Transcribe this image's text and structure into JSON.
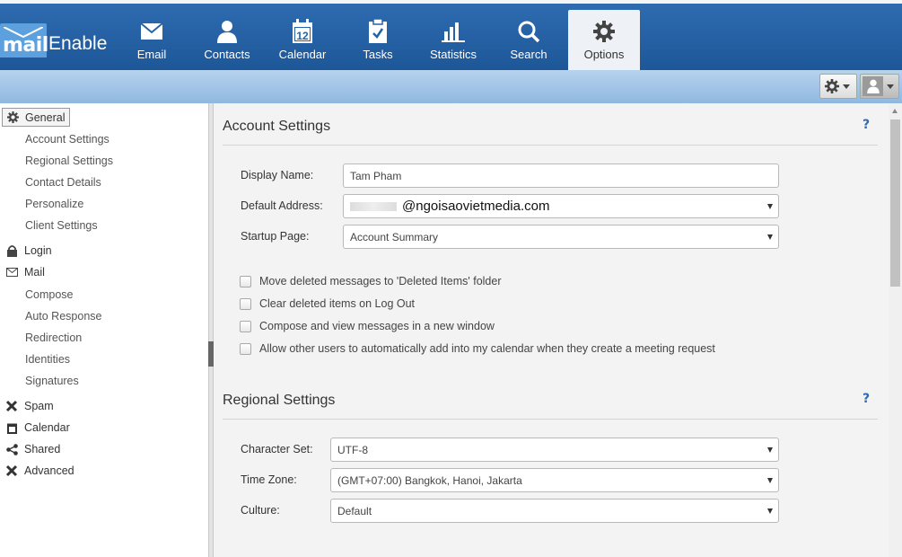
{
  "brand": {
    "logo_mail": "mail",
    "logo_enable": "Enable"
  },
  "nav": {
    "items": [
      {
        "label": "Email",
        "icon": "envelope-icon"
      },
      {
        "label": "Contacts",
        "icon": "person-icon"
      },
      {
        "label": "Calendar",
        "icon": "calendar-icon",
        "calendar_day": "12"
      },
      {
        "label": "Tasks",
        "icon": "clipboard-check-icon"
      },
      {
        "label": "Statistics",
        "icon": "bar-chart-icon"
      },
      {
        "label": "Search",
        "icon": "search-icon"
      },
      {
        "label": "Options",
        "icon": "gear-icon",
        "active": true
      }
    ]
  },
  "toolbar": {
    "settings_icon": "gear-icon",
    "user_icon": "user-icon"
  },
  "sidebar": {
    "general": "General",
    "general_items": [
      "Account Settings",
      "Regional Settings",
      "Contact Details",
      "Personalize",
      "Client Settings"
    ],
    "login": "Login",
    "mail": "Mail",
    "mail_items": [
      "Compose",
      "Auto Response",
      "Redirection",
      "Identities",
      "Signatures"
    ],
    "spam": "Spam",
    "calendar": "Calendar",
    "shared": "Shared",
    "advanced": "Advanced"
  },
  "account": {
    "title": "Account Settings",
    "help": "?",
    "display_name_label": "Display Name:",
    "display_name_value": "Tam Pham",
    "default_address_label": "Default Address:",
    "default_address_value": "@ngoisaovietmedia.com",
    "startup_page_label": "Startup Page:",
    "startup_page_value": "Account Summary",
    "options": [
      "Move deleted messages to 'Deleted Items' folder",
      "Clear deleted items on Log Out",
      "Compose and view messages in a new window",
      "Allow other users to automatically add into my calendar when they create a meeting request"
    ]
  },
  "regional": {
    "title": "Regional Settings",
    "help": "?",
    "charset_label": "Character Set:",
    "charset_value": "UTF-8",
    "timezone_label": "Time Zone:",
    "timezone_value": "(GMT+07:00) Bangkok, Hanoi, Jakarta",
    "culture_label": "Culture:",
    "culture_value": "Default"
  },
  "colors": {
    "nav_bg": "#2563a8",
    "subbar": "#a9c9ea",
    "link": "#2e6bb0"
  }
}
